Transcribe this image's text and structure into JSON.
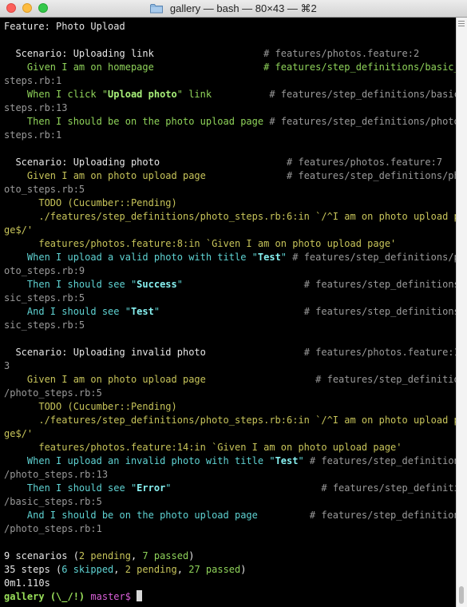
{
  "window": {
    "title": "gallery — bash — 80×43 — ⌘2"
  },
  "terminal": {
    "lines": [
      [
        {
          "t": "Feature: Photo Upload",
          "c": "w"
        }
      ],
      [],
      [
        {
          "t": "  Scenario: Uploading link                   ",
          "c": "w"
        },
        {
          "t": "# features/photos.feature:2",
          "c": "gr"
        }
      ],
      [
        {
          "t": "    Given I am on homepage                   # features/step_definitions/basic_",
          "c": "g"
        }
      ],
      [
        {
          "t": "steps.rb:1",
          "c": "gr"
        }
      ],
      [
        {
          "t": "    When I click \"",
          "c": "g"
        },
        {
          "t": "Upload photo",
          "c": "gb"
        },
        {
          "t": "\" link          ",
          "c": "g"
        },
        {
          "t": "# features/step_definitions/basic_",
          "c": "gr"
        }
      ],
      [
        {
          "t": "steps.rb:13",
          "c": "gr"
        }
      ],
      [
        {
          "t": "    Then I should be on the photo upload page ",
          "c": "g"
        },
        {
          "t": "# features/step_definitions/photo_",
          "c": "gr"
        }
      ],
      [
        {
          "t": "steps.rb:1",
          "c": "gr"
        }
      ],
      [],
      [
        {
          "t": "  Scenario: Uploading photo                      ",
          "c": "w"
        },
        {
          "t": "# features/photos.feature:7",
          "c": "gr"
        }
      ],
      [
        {
          "t": "    Given I am on photo upload page              ",
          "c": "y"
        },
        {
          "t": "# features/step_definitions/ph",
          "c": "gr"
        }
      ],
      [
        {
          "t": "oto_steps.rb:5",
          "c": "gr"
        }
      ],
      [
        {
          "t": "      TODO (Cucumber::Pending)",
          "c": "y"
        }
      ],
      [
        {
          "t": "      ./features/step_definitions/photo_steps.rb:6:in `/^I am on photo upload pa",
          "c": "y"
        }
      ],
      [
        {
          "t": "ge$/'",
          "c": "y"
        }
      ],
      [
        {
          "t": "      features/photos.feature:8:in `Given I am on photo upload page'",
          "c": "y"
        }
      ],
      [
        {
          "t": "    When I upload a valid photo with title \"",
          "c": "c"
        },
        {
          "t": "Test",
          "c": "cb"
        },
        {
          "t": "\" ",
          "c": "c"
        },
        {
          "t": "# features/step_definitions/ph",
          "c": "gr"
        }
      ],
      [
        {
          "t": "oto_steps.rb:9",
          "c": "gr"
        }
      ],
      [
        {
          "t": "    Then I should see \"",
          "c": "c"
        },
        {
          "t": "Success",
          "c": "cb"
        },
        {
          "t": "\"                     ",
          "c": "c"
        },
        {
          "t": "# features/step_definitions/ba",
          "c": "gr"
        }
      ],
      [
        {
          "t": "sic_steps.rb:5",
          "c": "gr"
        }
      ],
      [
        {
          "t": "    And I should see \"",
          "c": "c"
        },
        {
          "t": "Test",
          "c": "cb"
        },
        {
          "t": "\"                         ",
          "c": "c"
        },
        {
          "t": "# features/step_definitions/ba",
          "c": "gr"
        }
      ],
      [
        {
          "t": "sic_steps.rb:5",
          "c": "gr"
        }
      ],
      [],
      [
        {
          "t": "  Scenario: Uploading invalid photo                 ",
          "c": "w"
        },
        {
          "t": "# features/photos.feature:1",
          "c": "gr"
        }
      ],
      [
        {
          "t": "3",
          "c": "gr"
        }
      ],
      [
        {
          "t": "    Given I am on photo upload page                   ",
          "c": "y"
        },
        {
          "t": "# features/step_definitions",
          "c": "gr"
        }
      ],
      [
        {
          "t": "/photo_steps.rb:5",
          "c": "gr"
        }
      ],
      [
        {
          "t": "      TODO (Cucumber::Pending)",
          "c": "y"
        }
      ],
      [
        {
          "t": "      ./features/step_definitions/photo_steps.rb:6:in `/^I am on photo upload pa",
          "c": "y"
        }
      ],
      [
        {
          "t": "ge$/'",
          "c": "y"
        }
      ],
      [
        {
          "t": "      features/photos.feature:14:in `Given I am on photo upload page'",
          "c": "y"
        }
      ],
      [
        {
          "t": "    When I upload an invalid photo with title \"",
          "c": "c"
        },
        {
          "t": "Test",
          "c": "cb"
        },
        {
          "t": "\" ",
          "c": "c"
        },
        {
          "t": "# features/step_definitions",
          "c": "gr"
        }
      ],
      [
        {
          "t": "/photo_steps.rb:13",
          "c": "gr"
        }
      ],
      [
        {
          "t": "    Then I should see \"",
          "c": "c"
        },
        {
          "t": "Error",
          "c": "cb"
        },
        {
          "t": "\"                          ",
          "c": "c"
        },
        {
          "t": "# features/step_definitions",
          "c": "gr"
        }
      ],
      [
        {
          "t": "/basic_steps.rb:5",
          "c": "gr"
        }
      ],
      [
        {
          "t": "    And I should be on the photo upload page         ",
          "c": "c"
        },
        {
          "t": "# features/step_definitions",
          "c": "gr"
        }
      ],
      [
        {
          "t": "/photo_steps.rb:1",
          "c": "gr"
        }
      ],
      [],
      [
        {
          "t": "9 scenarios (",
          "c": "w"
        },
        {
          "t": "2 pending",
          "c": "y"
        },
        {
          "t": ", ",
          "c": "w"
        },
        {
          "t": "7 passed",
          "c": "g"
        },
        {
          "t": ")",
          "c": "w"
        }
      ],
      [
        {
          "t": "35 steps (",
          "c": "w"
        },
        {
          "t": "6 skipped",
          "c": "c"
        },
        {
          "t": ", ",
          "c": "w"
        },
        {
          "t": "2 pending",
          "c": "y"
        },
        {
          "t": ", ",
          "c": "w"
        },
        {
          "t": "27 passed",
          "c": "g"
        },
        {
          "t": ")",
          "c": "w"
        }
      ],
      [
        {
          "t": "0m1.110s",
          "c": "w"
        }
      ]
    ],
    "prompt": {
      "dir": "gallery",
      "status": "(\\_/!)",
      "branch": "master",
      "symbol": "$"
    }
  },
  "colors": {
    "background": "#000000",
    "text": "#e6e6e6",
    "passed": "#8fd35a",
    "pending": "#c7c45a",
    "skipped": "#5fd3d3",
    "comment": "#9a9a9a",
    "prompt_branch": "#d95fd8"
  },
  "icons": {
    "title_icon": "folder-icon",
    "scroll_grip": "scrollbar-grip-icon"
  }
}
